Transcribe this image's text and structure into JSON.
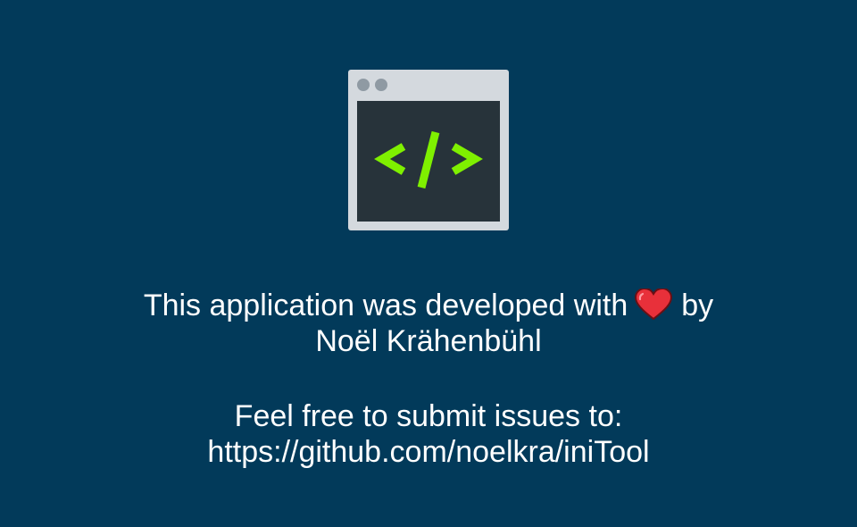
{
  "colors": {
    "background": "#023a5a",
    "window_frame": "#d4d9de",
    "window_screen": "#27333a",
    "code_glyph": "#7ff000",
    "heart": "#e8303a"
  },
  "icons": {
    "logo": "code-window-icon",
    "heart": "heart-icon"
  },
  "about": {
    "line1_before": "This application was developed with",
    "line1_after": "by",
    "author": "Noël Krähenbühl",
    "issues_label": "Feel free to submit issues to:",
    "issues_url": "https://github.com/noelkra/iniTool"
  }
}
